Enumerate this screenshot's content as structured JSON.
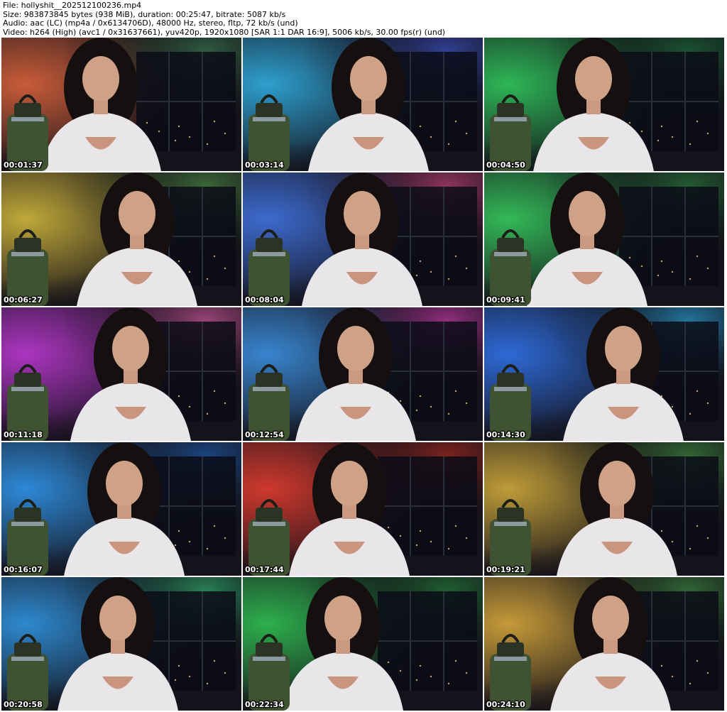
{
  "header": {
    "file_line": "File: hollyshit__202512100236.mp4",
    "size_line": "Size: 983873845 bytes (938 MiB), duration: 00:25:47, bitrate: 5087 kb/s",
    "audio_line": "Audio: aac (LC) (mp4a / 0x6134706D), 48000 Hz, stereo, fltp, 72 kb/s (und)",
    "video_line": "Video: h264 (High) (avc1 / 0x31637661), yuv420p, 1920x1080 [SAR 1:1 DAR 16:9], 5006 kb/s, 30.00 fps(r) (und)"
  },
  "thumbnails": [
    {
      "timestamp": "00:01:37",
      "light": "#d2603a",
      "accent": "#3c7a52"
    },
    {
      "timestamp": "00:03:14",
      "light": "#2fa7d8",
      "accent": "#3d54c8"
    },
    {
      "timestamp": "00:04:50",
      "light": "#2fbf5a",
      "accent": "#1d6d3c"
    },
    {
      "timestamp": "00:06:27",
      "light": "#c9b03a",
      "accent": "#4d8a44"
    },
    {
      "timestamp": "00:08:04",
      "light": "#3f6fd8",
      "accent": "#c2437a"
    },
    {
      "timestamp": "00:09:41",
      "light": "#35c25b",
      "accent": "#2b7a3d"
    },
    {
      "timestamp": "00:11:18",
      "light": "#b437c9",
      "accent": "#d35a9e"
    },
    {
      "timestamp": "00:12:54",
      "light": "#3a8bd8",
      "accent": "#c63aa8"
    },
    {
      "timestamp": "00:14:30",
      "light": "#2f6ee0",
      "accent": "#2a9fd6"
    },
    {
      "timestamp": "00:16:07",
      "light": "#2f8fe0",
      "accent": "#1e5aa8"
    },
    {
      "timestamp": "00:17:44",
      "light": "#d83a2e",
      "accent": "#a82a20"
    },
    {
      "timestamp": "00:19:21",
      "light": "#c7a33a",
      "accent": "#3f8a3e"
    },
    {
      "timestamp": "00:20:58",
      "light": "#2f8fd8",
      "accent": "#30b070"
    },
    {
      "timestamp": "00:22:34",
      "light": "#2fb850",
      "accent": "#24803a"
    },
    {
      "timestamp": "00:24:10",
      "light": "#cfa13a",
      "accent": "#3d8a40"
    }
  ]
}
